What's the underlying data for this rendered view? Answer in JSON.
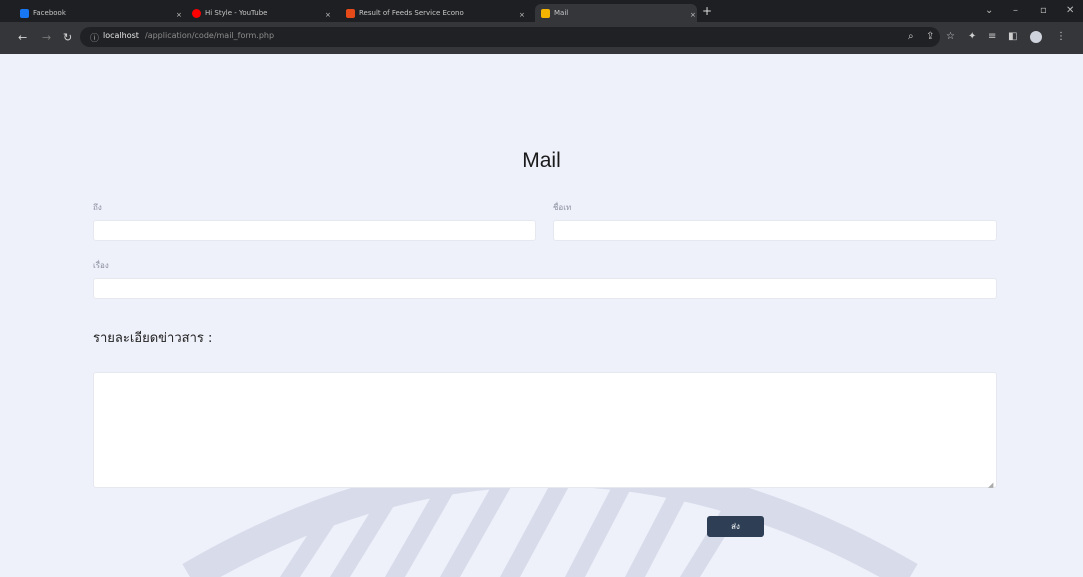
{
  "browser": {
    "tabs": [
      {
        "label": "Facebook",
        "color": "#1877f2"
      },
      {
        "label": "Hi Style - YouTube",
        "color": "#ff0000"
      },
      {
        "label": "Result of Feeds Service Econo",
        "color": "#e64a19"
      },
      {
        "label": "Mail",
        "color": "#f4b400"
      }
    ],
    "url_host": "localhost",
    "url_path": "/application/code/mail_form.php"
  },
  "page": {
    "title": "Mail",
    "fields": {
      "to_label": "ถึง",
      "from_label": "ชื่อเท",
      "subject_label": "เรื่อง",
      "message_label": "รายละเอียดข่าวสาร :"
    },
    "submit_label": "ส่ง"
  }
}
